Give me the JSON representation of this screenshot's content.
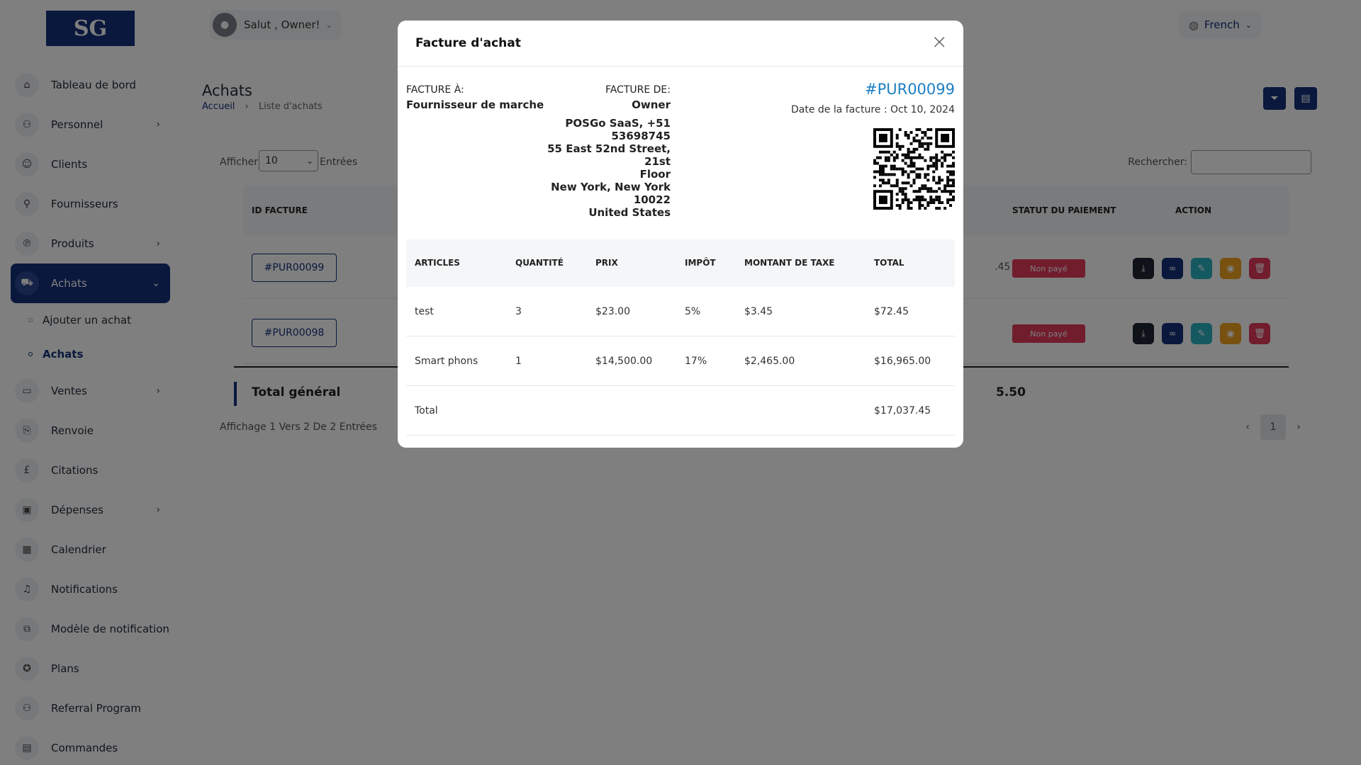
{
  "sidebar": {
    "logo_text": "SG",
    "items": [
      {
        "label": "Tableau de bord",
        "icon": "home-icon",
        "chevron": false
      },
      {
        "label": "Personnel",
        "icon": "users-icon",
        "chevron": true
      },
      {
        "label": "Clients",
        "icon": "user-icon",
        "chevron": false
      },
      {
        "label": "Fournisseurs",
        "icon": "user-plus-icon",
        "chevron": false
      },
      {
        "label": "Produits",
        "icon": "product-icon",
        "chevron": true
      },
      {
        "label": "Achats",
        "icon": "cart-icon",
        "chevron": true,
        "active": true
      },
      {
        "label": "Ventes",
        "icon": "book-icon",
        "chevron": true
      },
      {
        "label": "Renvoie",
        "icon": "return-icon",
        "chevron": false
      },
      {
        "label": "Citations",
        "icon": "pound-icon",
        "chevron": false
      },
      {
        "label": "Dépenses",
        "icon": "expense-icon",
        "chevron": true
      },
      {
        "label": "Calendrier",
        "icon": "calendar-icon",
        "chevron": false
      },
      {
        "label": "Notifications",
        "icon": "bell-icon",
        "chevron": false
      },
      {
        "label": "Modèle de notification",
        "icon": "template-icon",
        "chevron": false
      },
      {
        "label": "Plans",
        "icon": "award-icon",
        "chevron": false
      },
      {
        "label": "Referral Program",
        "icon": "referral-icon",
        "chevron": false
      },
      {
        "label": "Commandes",
        "icon": "orders-icon",
        "chevron": false
      }
    ],
    "sub_items": [
      {
        "label": "Ajouter un achat"
      },
      {
        "label": "Achats"
      }
    ]
  },
  "header": {
    "user_greeting": "Salut , Owner!",
    "language": "French"
  },
  "page": {
    "title": "Achats",
    "breadcrumb_home": "Accueil",
    "breadcrumb_sep": "›",
    "breadcrumb_current": "Liste d'achats"
  },
  "table": {
    "show_label": "Afficher",
    "show_value": "10",
    "entries_label": "Entrées",
    "search_label": "Rechercher:",
    "columns": {
      "invoice_id": "ID FACTURE",
      "payment_status": "STATUT DU PAIEMENT",
      "action": "ACTION"
    },
    "rows": [
      {
        "invoice_id": "#PUR00099",
        "amount_fragment": ".45",
        "status": "Non payé"
      },
      {
        "invoice_id": "#PUR00098",
        "amount_fragment": "",
        "status": "Non payé"
      }
    ],
    "total_label": "Total général",
    "total_fragment": "5.50",
    "footer_text": "Affichage 1 Vers 2 De 2 Entrées",
    "current_page": "1"
  },
  "colors": {
    "primary": "#14307a",
    "status_unpaid": "#e23b5b",
    "action_download": "#1f2430",
    "action_link": "#14307a",
    "action_edit": "#2bb3c0",
    "action_view": "#f0a020",
    "action_delete": "#e23b5b",
    "invoice_link": "#1e7fc4"
  },
  "modal": {
    "title": "Facture d'achat",
    "bill_to_label": "FACTURE À:",
    "bill_to_name": "Fournisseur de marche",
    "bill_from_label": "FACTURE DE:",
    "bill_from_name": "Owner",
    "address_lines": [
      "POSGo SaaS, +51",
      "53698745",
      "55 East 52nd Street, 21st",
      "Floor",
      "New York, New York",
      "10022",
      "United States"
    ],
    "invoice_id": "#PUR00099",
    "invoice_date": "Date de la facture : Oct 10, 2024",
    "columns": [
      "ARTICLES",
      "QUANTITÉ",
      "PRIX",
      "IMPÔT",
      "MONTANT DE TAXE",
      "TOTAL"
    ],
    "items": [
      {
        "article": "test",
        "qty": "3",
        "price": "$23.00",
        "tax": "5%",
        "tax_amount": "$3.45",
        "total": "$72.45"
      },
      {
        "article": "Smart phons",
        "qty": "1",
        "price": "$14,500.00",
        "tax": "17%",
        "tax_amount": "$2,465.00",
        "total": "$16,965.00"
      }
    ],
    "total_label": "Total",
    "total_value": "$17,037.45"
  }
}
